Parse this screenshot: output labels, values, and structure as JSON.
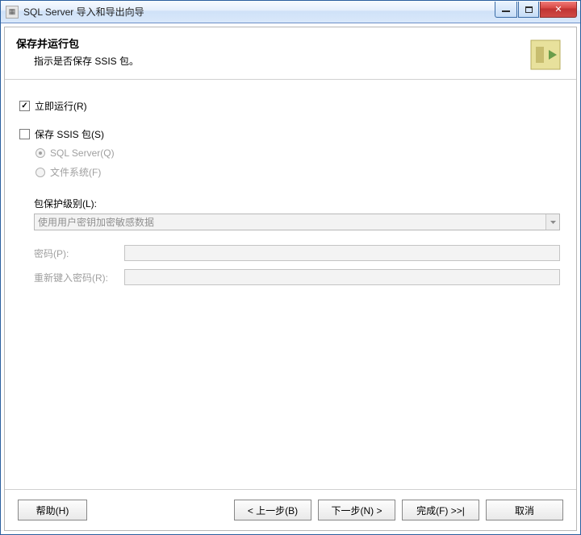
{
  "window": {
    "title": "SQL Server 导入和导出向导"
  },
  "header": {
    "title": "保存并运行包",
    "subtitle": "指示是否保存 SSIS 包。"
  },
  "options": {
    "run_now": {
      "label": "立即运行(R)",
      "checked": true
    },
    "save_ssis": {
      "label": "保存 SSIS 包(S)",
      "checked": false
    },
    "sql_server": {
      "label": "SQL Server(Q)"
    },
    "file_system": {
      "label": "文件系统(F)"
    }
  },
  "protection": {
    "label": "包保护级别(L):",
    "selected": "使用用户密钥加密敏感数据"
  },
  "password": {
    "label": "密码(P):",
    "retype_label": "重新键入密码(R):"
  },
  "buttons": {
    "help": "帮助(H)",
    "back": "< 上一步(B)",
    "next": "下一步(N) >",
    "finish": "完成(F) >>|",
    "cancel": "取消"
  }
}
